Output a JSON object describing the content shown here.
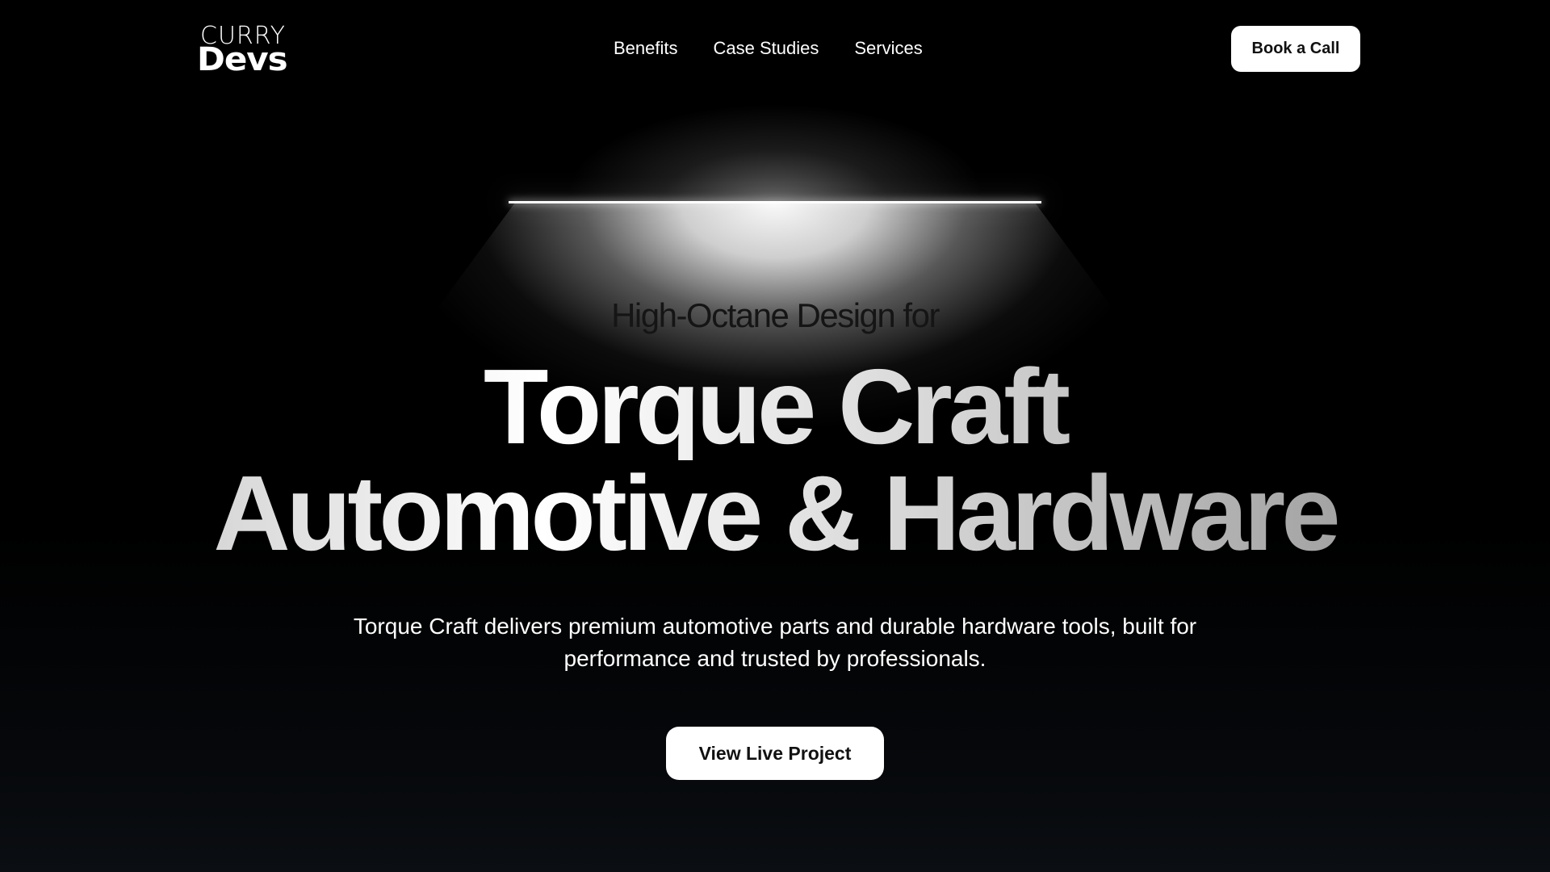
{
  "header": {
    "logo": {
      "top": "CURRY",
      "bottom": "Devs"
    },
    "nav": [
      {
        "label": "Benefits"
      },
      {
        "label": "Case Studies"
      },
      {
        "label": "Services"
      }
    ],
    "cta_label": "Book a Call"
  },
  "hero": {
    "eyebrow": "High-Octane Design for",
    "title_line_1": "Torque Craft",
    "title_line_2": "Automotive & Hardware",
    "subtitle": "Torque Craft delivers premium automotive parts and durable hardware tools, built for performance and trusted by professionals.",
    "cta_label": "View Live Project"
  },
  "colors": {
    "background": "#000000",
    "button_bg": "#ffffff",
    "button_text": "#111111"
  }
}
